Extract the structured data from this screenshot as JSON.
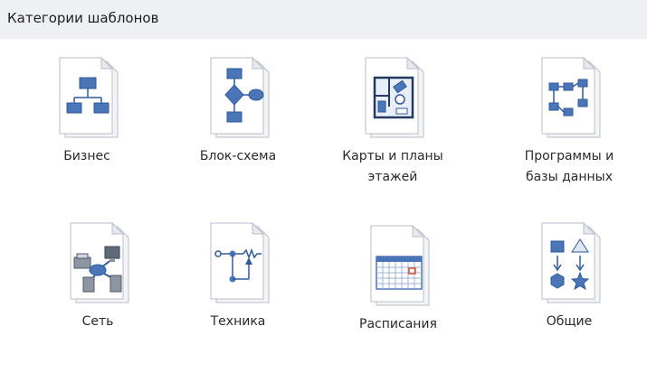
{
  "header": {
    "title": "Категории шаблонов"
  },
  "categories": [
    {
      "label": "Бизнес",
      "icon": "business-org-chart-icon"
    },
    {
      "label": "Блок-схема",
      "icon": "flowchart-icon"
    },
    {
      "label": "Карты и планы\nэтажей",
      "icon": "floor-plan-icon"
    },
    {
      "label": "Программы и\nбазы данных",
      "icon": "software-database-icon"
    },
    {
      "label": "Сеть",
      "icon": "network-icon"
    },
    {
      "label": "Техника",
      "icon": "engineering-icon"
    },
    {
      "label": "Расписания",
      "icon": "schedule-calendar-icon"
    },
    {
      "label": "Общие",
      "icon": "general-shapes-icon"
    }
  ],
  "colors": {
    "header_bg": "#eef0f3",
    "shape_blue": "#4a76b8",
    "paper_fold": "#e6e9ee",
    "accent_red": "#e0522d"
  }
}
